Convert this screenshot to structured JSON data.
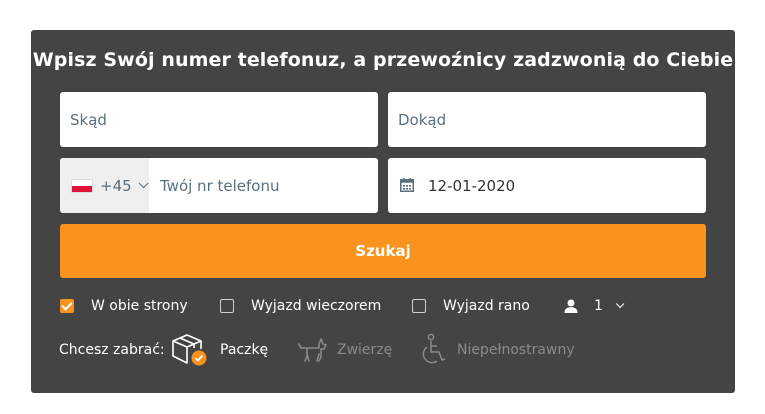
{
  "title": "Wpisz Swój numer telefonuz, a przewoźnicy zadzwonią do Ciebie",
  "from": {
    "placeholder": "Skąd"
  },
  "to": {
    "placeholder": "Dokąd"
  },
  "phone": {
    "prefix": "+45",
    "placeholder": "Twój nr telefonu",
    "flag": "poland-flag"
  },
  "date": {
    "value": "12-01-2020",
    "icon": "calendar-icon"
  },
  "search_button": "Szukaj",
  "options": {
    "both_ways": {
      "label": "W obie strony",
      "checked": true
    },
    "evening": {
      "label": "Wyjazd wieczorem",
      "checked": false
    },
    "morning": {
      "label": "Wyjazd rano",
      "checked": false
    }
  },
  "passengers": {
    "count": "1",
    "icon": "person-icon"
  },
  "take": {
    "label": "Chcesz zabrać:",
    "items": [
      {
        "label": "Paczkę",
        "icon": "package-icon",
        "selected": true
      },
      {
        "label": "Zwierzę",
        "icon": "dog-icon",
        "selected": false
      },
      {
        "label": "Niepełnostrawny",
        "icon": "wheelchair-icon",
        "selected": false
      }
    ]
  },
  "colors": {
    "panel": "#444444",
    "accent": "#f7931e",
    "muted": "#8a8a8a"
  }
}
